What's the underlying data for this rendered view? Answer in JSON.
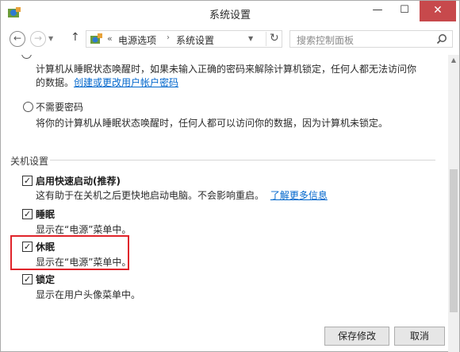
{
  "window": {
    "title": "系统设置"
  },
  "titlebar_buttons": {
    "minimize": "—",
    "maximize": "☐",
    "close": "✕"
  },
  "nav": {
    "back": "←",
    "forward": "→",
    "up": "↑",
    "breadcrumb_chevron": "«",
    "crumbs": [
      "电源选项",
      "系统设置"
    ],
    "crumb_separator": "›",
    "refresh": "↻",
    "search_placeholder": "搜索控制面板"
  },
  "password": {
    "require_desc_line1": "计算机从睡眠状态唤醒时，如果未输入正确的密码来解除计算机锁定，任何人都无法访问你",
    "require_desc_line2": "的数据。",
    "require_link": "创建或更改用户帐户密码",
    "no_password_label": "不需要密码",
    "no_password_desc": "将你的计算机从睡眠状态唤醒时，任何人都可以访问你的数据，因为计算机未锁定。"
  },
  "shutdown": {
    "section_title": "关机设置",
    "items": [
      {
        "label": "启用快速启动(推荐)",
        "desc": "这有助于在关机之后更快地启动电脑。不会影响重启。",
        "link": "了解更多信息",
        "checked": true
      },
      {
        "label": "睡眠",
        "desc": "显示在“电源”菜单中。",
        "checked": true
      },
      {
        "label": "休眠",
        "desc": "显示在“电源”菜单中。",
        "checked": true
      },
      {
        "label": "锁定",
        "desc": "显示在用户头像菜单中。",
        "checked": true
      }
    ]
  },
  "buttons": {
    "save": "保存修改",
    "cancel": "取消"
  },
  "colors": {
    "accent_link": "#0066cc",
    "highlight_border": "#e0242b",
    "close_button": "#c7494c"
  }
}
